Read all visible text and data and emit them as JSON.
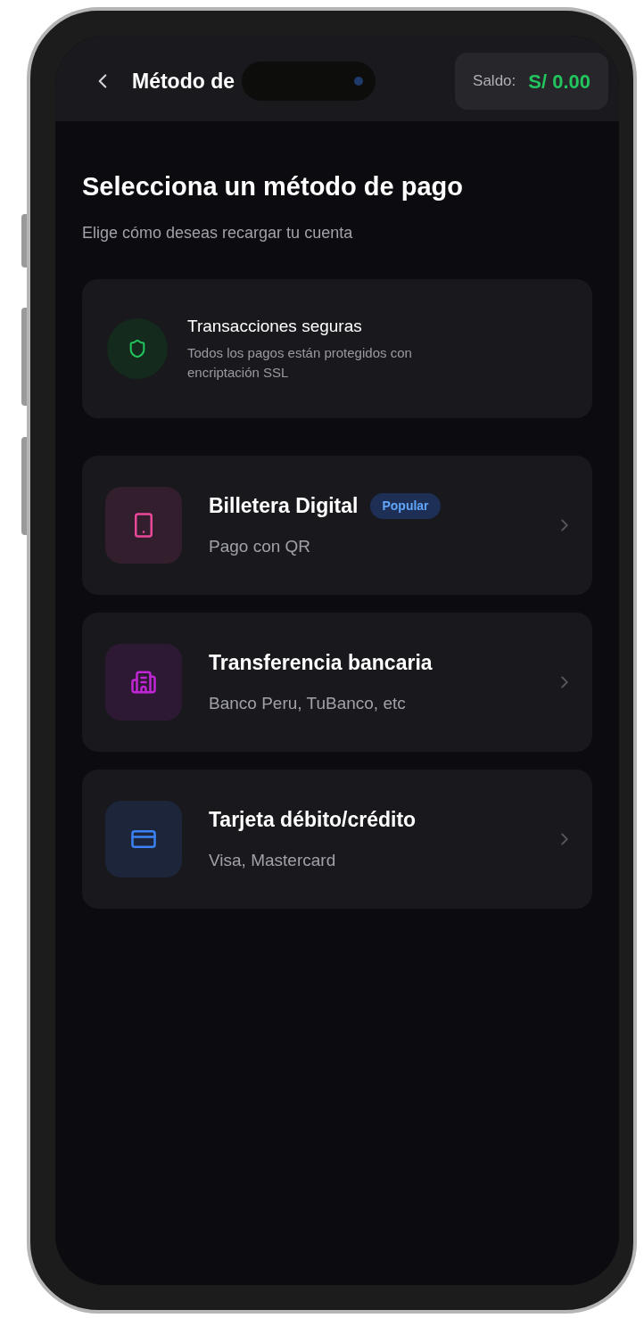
{
  "header": {
    "title": "Método de",
    "balance_label": "Saldo:",
    "balance_value": "S/ 0.00"
  },
  "heading": "Selecciona un método de pago",
  "subheading": "Elige cómo deseas recargar tu cuenta",
  "security_notice": {
    "title": "Transacciones seguras",
    "text": "Todos los pagos están protegidos con encriptación SSL"
  },
  "methods": [
    {
      "kind": "phone",
      "color": "#ec4899",
      "title": "Billetera Digital",
      "badge": "Popular",
      "subtitle": "Pago con QR"
    },
    {
      "kind": "bank",
      "color": "#c026d3",
      "title": "Transferencia bancaria",
      "subtitle": "Banco Peru, TuBanco, etc"
    },
    {
      "kind": "card",
      "color": "#3b82f6",
      "title": "Tarjeta débito/crédito",
      "subtitle": "Visa, Mastercard"
    }
  ]
}
